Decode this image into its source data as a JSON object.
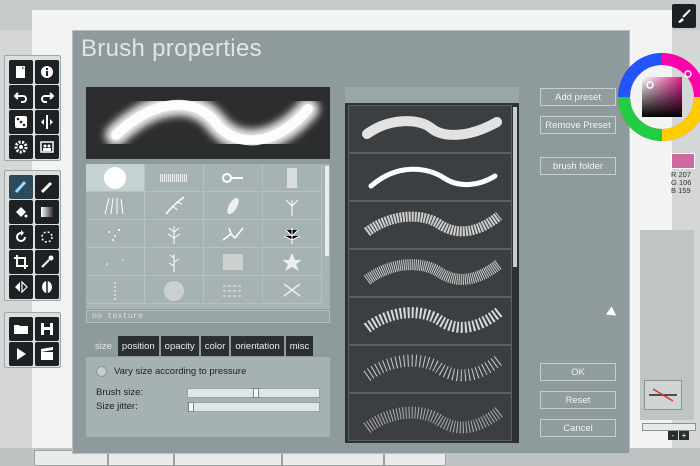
{
  "dialog": {
    "title": "Brush properties",
    "texture_label": "no texture",
    "tabs": [
      "size",
      "position",
      "opacity",
      "color",
      "orientation",
      "misc"
    ],
    "active_tab": "size",
    "pressure_option": "Vary size according to pressure",
    "sliders": {
      "brush_size": {
        "label": "Brush size:",
        "value": 0.52
      },
      "size_jitter": {
        "label": "Size jitter:",
        "value": 0.0
      }
    },
    "buttons": {
      "add_preset": "Add preset",
      "remove_preset": "Remove Preset",
      "brush_folder": "brush folder",
      "ok": "OK",
      "reset": "Reset",
      "cancel": "Cancel"
    }
  },
  "color": {
    "current_hex": "#cf6a9f",
    "r_label": "R",
    "r": "207",
    "g_label": "G",
    "g": "106",
    "b_label": "B",
    "b": "159"
  },
  "icons": {
    "top_right": "brush-settings-icon",
    "left_tools": [
      "new-layer-icon",
      "info-icon",
      "undo-icon",
      "redo-icon",
      "dice-icon",
      "symmetry-icon",
      "settings-icon",
      "layers-icon",
      "brush-icon",
      "pencil-icon",
      "fill-icon",
      "gradient-icon",
      "rotate-icon",
      "lasso-icon",
      "crop-icon",
      "eyedropper-icon",
      "flip-icon",
      "filter-icon",
      "folder-icon",
      "save-icon",
      "play-icon",
      "clapper-icon"
    ]
  }
}
